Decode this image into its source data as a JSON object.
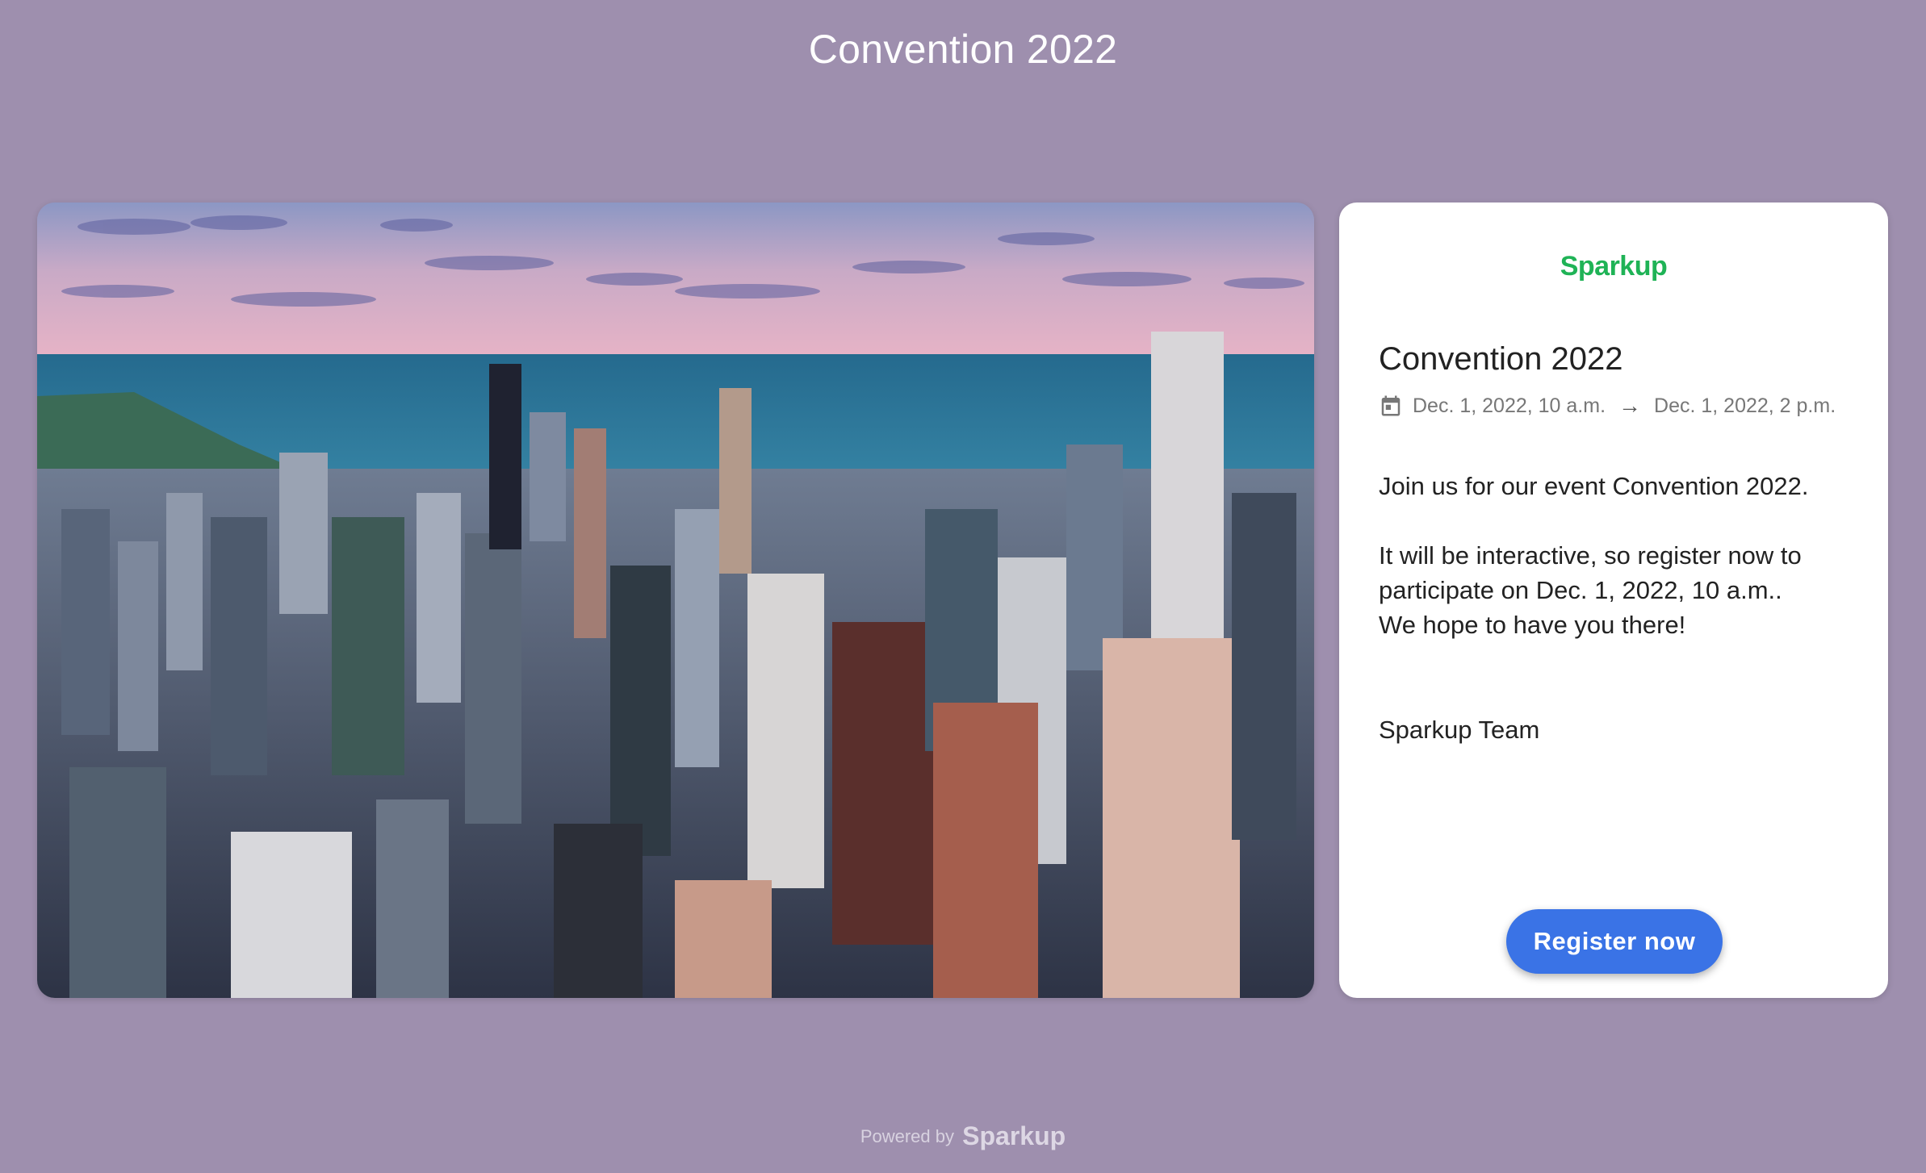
{
  "page": {
    "title": "Convention 2022"
  },
  "card": {
    "brand": "Sparkup",
    "title": "Convention 2022",
    "start": "Dec. 1, 2022, 10 a.m.",
    "arrow": "→",
    "end": "Dec. 1, 2022, 2 p.m.",
    "description": {
      "line1": "Join us for our event Convention 2022.",
      "line2": "It will be interactive, so register now to participate on Dec. 1, 2022, 10 a.m..",
      "line3": "We hope to have you there!"
    },
    "signature": "Sparkup Team",
    "register_label": "Register now"
  },
  "footer": {
    "powered_by": "Powered by",
    "brand": "Sparkup"
  },
  "colors": {
    "background": "#9e8fae",
    "brand_green": "#1fb356",
    "button_blue": "#3a73e6"
  },
  "icons": {
    "date": "calendar-icon"
  }
}
